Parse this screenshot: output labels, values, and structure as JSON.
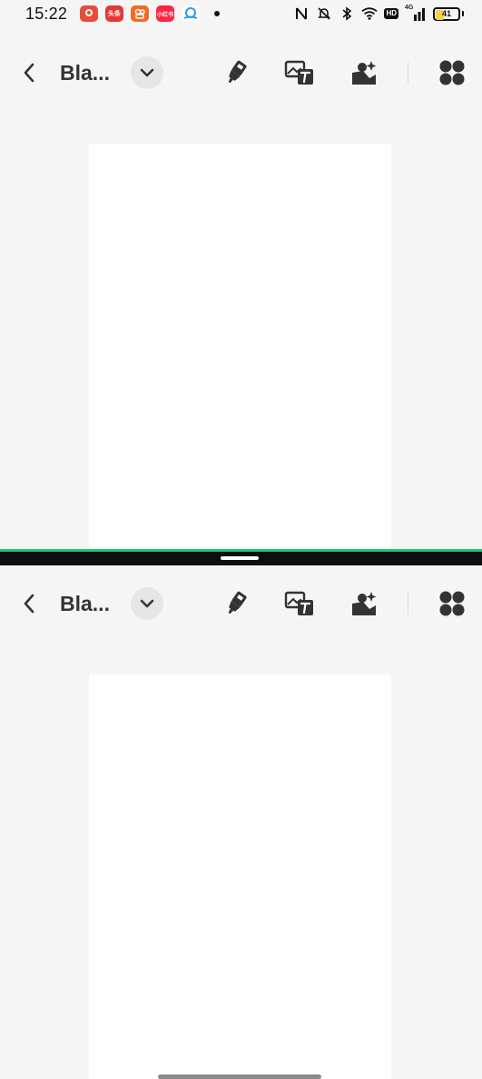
{
  "status_bar": {
    "time": "15:22",
    "app_icons": [
      {
        "name": "location-app-icon",
        "color": "#e94c3d",
        "label": ""
      },
      {
        "name": "toutiao-app-icon",
        "color": "#e53935",
        "label": "头条"
      },
      {
        "name": "kuaishou-app-icon",
        "color": "#f36a21",
        "label": ""
      },
      {
        "name": "xiaohongshu-app-icon",
        "color": "#ff2442",
        "label": "小红书"
      },
      {
        "name": "cloud-app-icon",
        "color": "#2b9cf0",
        "label": ""
      }
    ],
    "battery_level": "41",
    "battery_fill_percent": 41,
    "network_label": "4G",
    "hd_label": "HD"
  },
  "toolbar_top": {
    "title": "Bla..."
  },
  "toolbar_bottom": {
    "title": "Bla..."
  },
  "colors": {
    "background": "#f5f5f5",
    "page": "#ffffff",
    "divider": "#0f0f0f",
    "divider_accent": "#22c272",
    "icon": "#333333"
  },
  "icons": [
    "back-icon",
    "chevron-down-icon",
    "highlighter-icon",
    "image-text-icon",
    "image-ai-icon",
    "apps-grid-icon"
  ]
}
